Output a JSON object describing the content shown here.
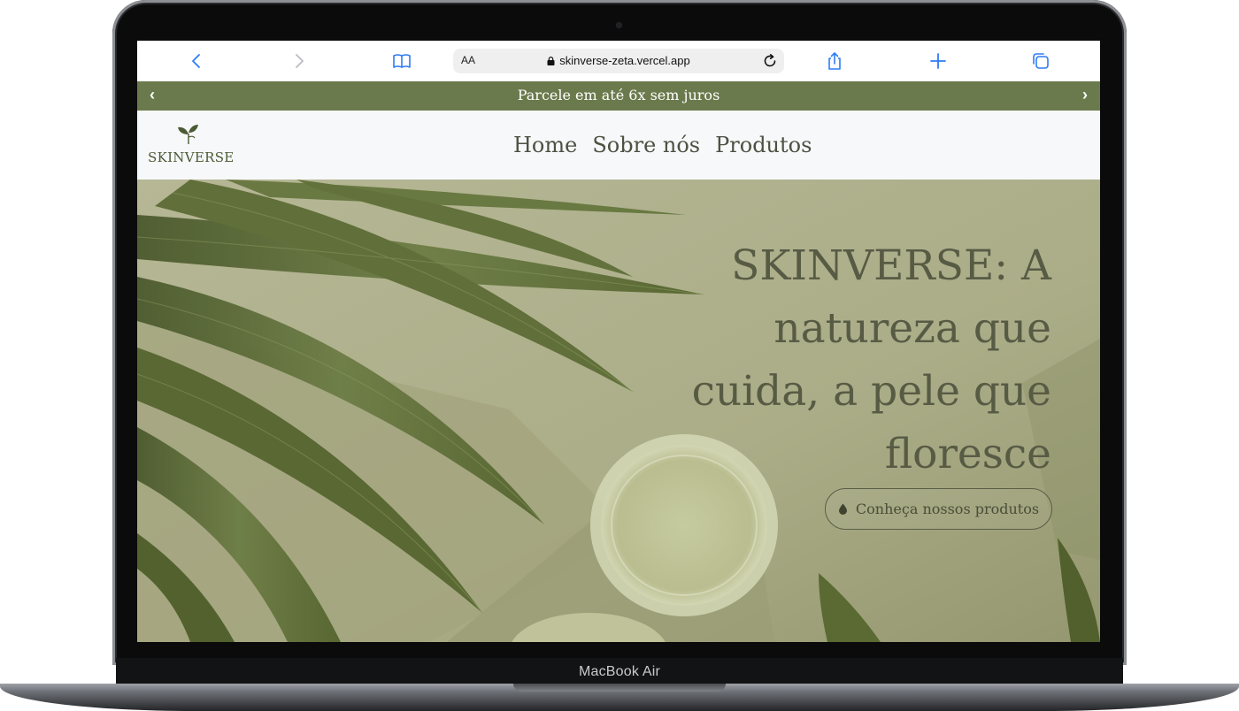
{
  "device": {
    "model_label": "MacBook Air"
  },
  "browser": {
    "url_aa": "AA",
    "url": "skinverse-zeta.vercel.app",
    "icons": {
      "back": "chevron-left-icon",
      "forward": "chevron-right-icon",
      "bookmarks": "book-icon",
      "lock": "lock-icon",
      "reload": "reload-icon",
      "share": "share-icon",
      "new_tab": "plus-icon",
      "tabs": "tabs-icon"
    }
  },
  "announcement": {
    "text": "Parcele em até 6x sem juros",
    "prev_arrow": "‹",
    "next_arrow": "›",
    "background_color": "#6b7a4c"
  },
  "header": {
    "logo_text": "SKINVERSE",
    "logo_icon": "leaf-icon",
    "nav": [
      {
        "label": "Home"
      },
      {
        "label": "Sobre nós"
      },
      {
        "label": "Produtos"
      }
    ]
  },
  "hero": {
    "title": "SKINVERSE: A natureza que cuida, a pele que floresce",
    "cta_label": "Conheça nossos produtos",
    "cta_icon": "drop-icon",
    "background_color": "#aeb08d",
    "text_color": "#585b44"
  }
}
